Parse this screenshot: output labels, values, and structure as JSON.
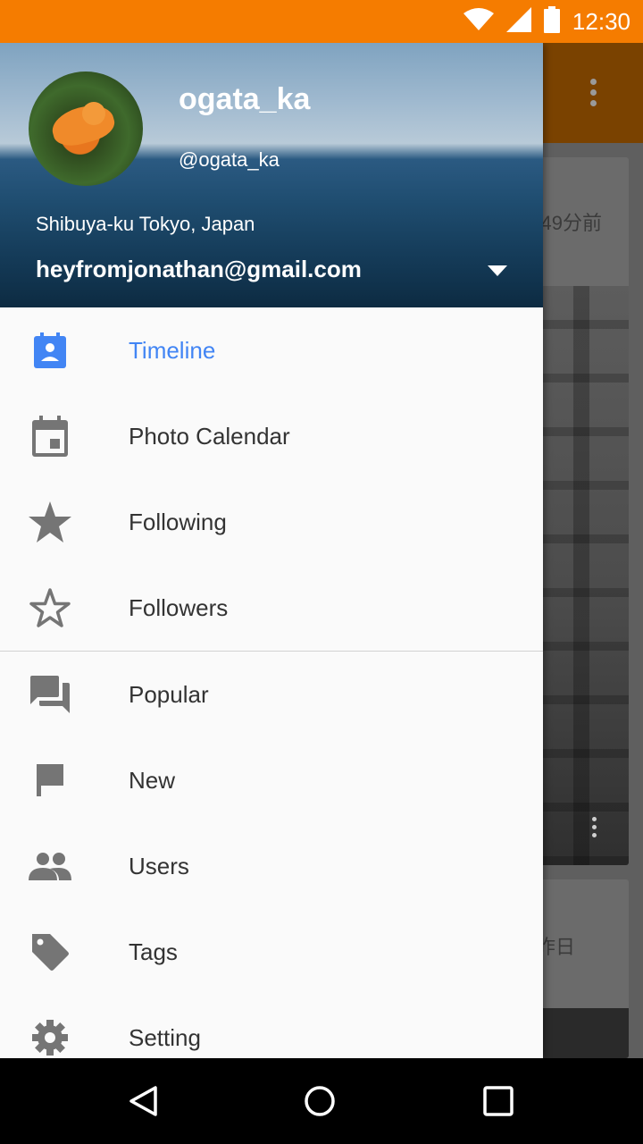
{
  "status_bar": {
    "time": "12:30",
    "icons": [
      "wifi-icon",
      "signal-icon",
      "battery-icon"
    ]
  },
  "background_app": {
    "card1_time": "49分前",
    "card2_time": "昨日"
  },
  "drawer": {
    "header": {
      "username": "ogata_ka",
      "handle": "@ogata_ka",
      "location": "Shibuya-ku Tokyo, Japan",
      "email": "heyfromjonathan@gmail.com"
    },
    "items": [
      {
        "label": "Timeline",
        "icon": "contact-calendar-icon",
        "active": true
      },
      {
        "label": "Photo Calendar",
        "icon": "calendar-icon"
      },
      {
        "label": "Following",
        "icon": "star-filled-icon"
      },
      {
        "label": "Followers",
        "icon": "star-outline-icon"
      },
      {
        "label": "Popular",
        "icon": "forum-icon"
      },
      {
        "label": "New",
        "icon": "flag-icon"
      },
      {
        "label": "Users",
        "icon": "people-icon"
      },
      {
        "label": "Tags",
        "icon": "tag-icon"
      },
      {
        "label": "Setting",
        "icon": "gear-icon"
      }
    ]
  },
  "colors": {
    "status_bar": "#F57C00",
    "accent": "#4285F4",
    "icon_gray": "#757575"
  }
}
